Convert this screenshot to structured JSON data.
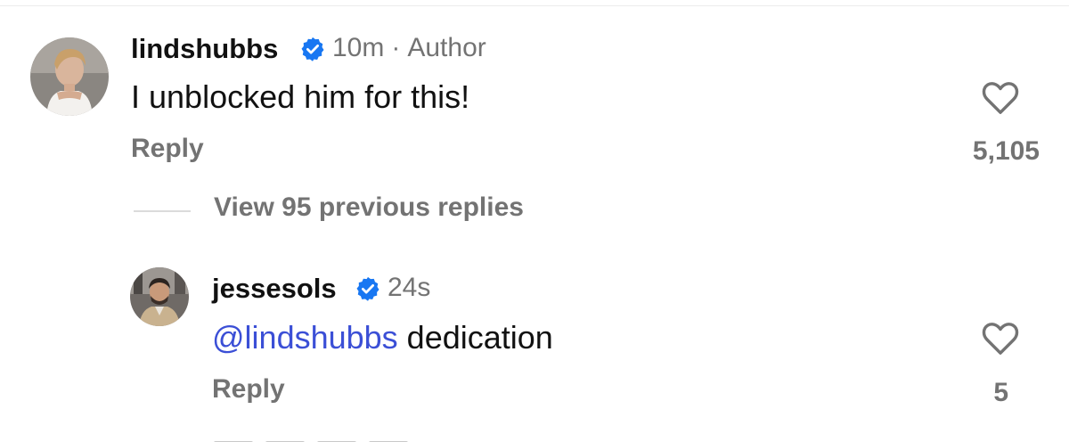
{
  "comments": [
    {
      "username": "lindshubbs",
      "time": "10m",
      "separator": "·",
      "role": "Author",
      "text": "I unblocked him for this!",
      "reply_label": "Reply",
      "likes": "5,105",
      "avatar_icon": "avatar-photo-woman",
      "verified_icon": "verified-badge-icon"
    }
  ],
  "view_replies_label": "View 95 previous replies",
  "replies": [
    {
      "username": "jessesols",
      "time": "24s",
      "mention": "@lindshubbs",
      "text": " dedication",
      "reply_label": "Reply",
      "likes": "5",
      "avatar_icon": "avatar-photo-man",
      "verified_icon": "verified-badge-icon"
    }
  ],
  "colors": {
    "text": "#111111",
    "muted": "#737373",
    "mention": "#3b4fd6",
    "verified": "#1877f2"
  }
}
